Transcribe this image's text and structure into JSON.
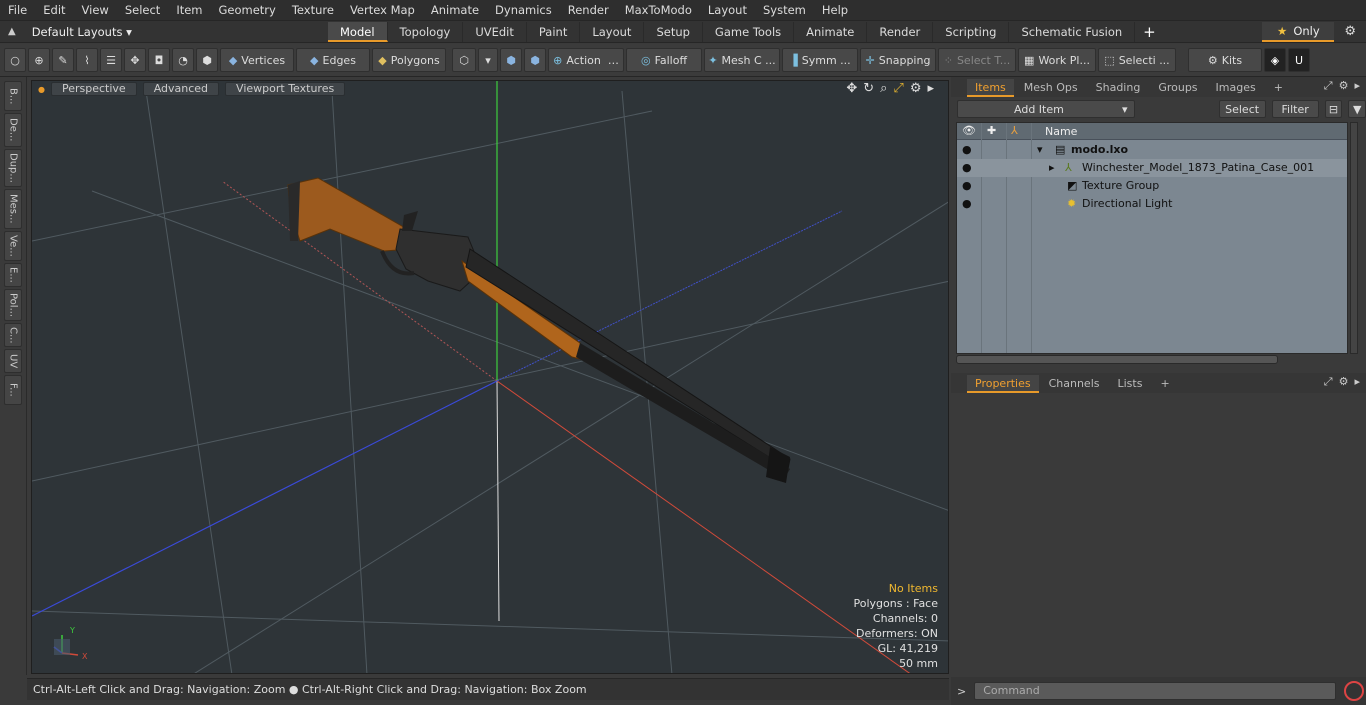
{
  "menu": [
    "File",
    "Edit",
    "View",
    "Select",
    "Item",
    "Geometry",
    "Texture",
    "Vertex Map",
    "Animate",
    "Dynamics",
    "Render",
    "MaxToModo",
    "Layout",
    "System",
    "Help"
  ],
  "layout": {
    "selector": "Default Layouts",
    "tabs": [
      {
        "label": "Model",
        "active": true
      },
      {
        "label": "Topology",
        "active": false
      },
      {
        "label": "UVEdit",
        "active": false
      },
      {
        "label": "Paint",
        "active": false
      },
      {
        "label": "Layout",
        "active": false
      },
      {
        "label": "Setup",
        "active": false
      },
      {
        "label": "Game Tools",
        "active": false
      },
      {
        "label": "Animate",
        "active": false
      },
      {
        "label": "Render",
        "active": false
      },
      {
        "label": "Scripting",
        "active": false
      },
      {
        "label": "Schematic Fusion",
        "active": false
      }
    ],
    "add_tab": "+",
    "only_label": "Only"
  },
  "toolbar": {
    "vertices": "Vertices",
    "edges": "Edges",
    "polygons": "Polygons",
    "action": "Action",
    "falloff": "Falloff",
    "mesh": "Mesh C ...",
    "symm": "Symm ...",
    "snapping": "Snapping",
    "select_t": "Select T...",
    "workplane": "Work Pl...",
    "selecti": "Selecti ...",
    "kits": "Kits"
  },
  "left_tabs": [
    "B...",
    "De...",
    "Dup...",
    "Mes...",
    "Ve...",
    "E...",
    "Pol...",
    "C...",
    "UV",
    "F..."
  ],
  "viewport": {
    "view_mode": "Perspective",
    "advanced": "Advanced",
    "textures": "Viewport Textures",
    "info": {
      "no_items": "No Items",
      "polygons": "Polygons : Face",
      "channels": "Channels: 0",
      "deformers": "Deformers: ON",
      "gl": "GL: 41,219",
      "scale": "50 mm"
    }
  },
  "status": "Ctrl-Alt-Left Click and Drag: Navigation: Zoom ● Ctrl-Alt-Right Click and Drag: Navigation: Box Zoom",
  "items_panel": {
    "tabs": [
      {
        "label": "Items",
        "active": true
      },
      {
        "label": "Mesh Ops",
        "active": false
      },
      {
        "label": "Shading",
        "active": false
      },
      {
        "label": "Groups",
        "active": false
      },
      {
        "label": "Images",
        "active": false
      }
    ],
    "add_tab": "+",
    "add_item": "Add Item",
    "select": "Select",
    "filter": "Filter",
    "col_name": "Name",
    "rows": [
      {
        "label": "modo.lxo"
      },
      {
        "label": "Winchester_Model_1873_Patina_Case_001"
      },
      {
        "label": "Texture Group"
      },
      {
        "label": "Directional Light"
      }
    ]
  },
  "properties_panel": {
    "tabs": [
      {
        "label": "Properties",
        "active": true
      },
      {
        "label": "Channels",
        "active": false
      },
      {
        "label": "Lists",
        "active": false
      }
    ],
    "add_tab": "+"
  },
  "command": {
    "placeholder": "Command"
  },
  "colors": {
    "accent": "#e89a2a",
    "viewport_bg": "#2e3438",
    "list_bg": "#7c8791",
    "warn": "#f0b830"
  }
}
